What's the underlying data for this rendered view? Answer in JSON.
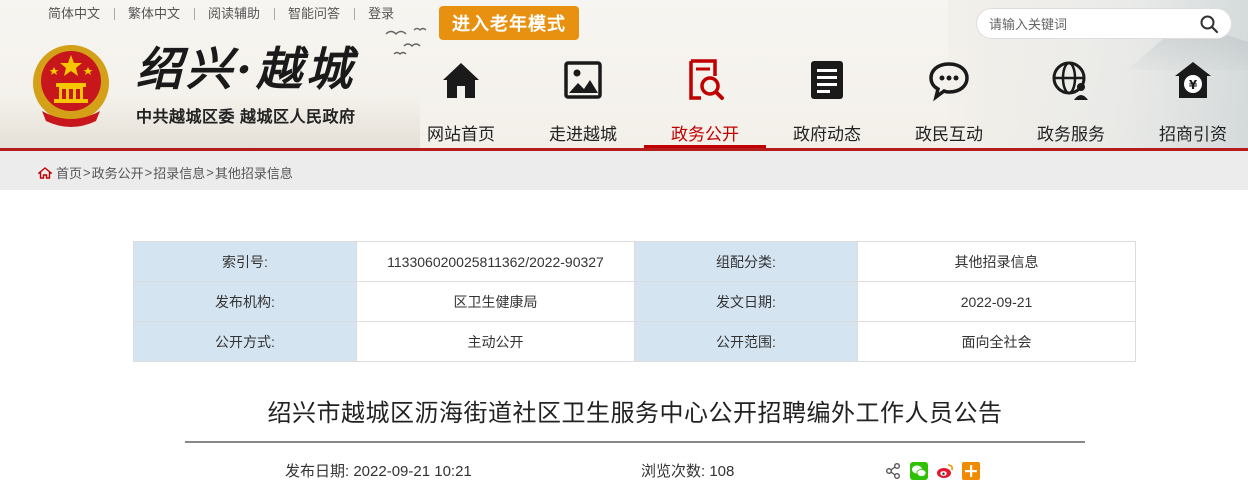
{
  "toplinks": [
    "简体中文",
    "繁体中文",
    "阅读辅助",
    "智能问答",
    "登录"
  ],
  "elder_mode": "进入老年模式",
  "search": {
    "placeholder": "请输入关键词"
  },
  "logo": {
    "title": "绍兴·越城",
    "subtitle": "中共越城区委 越城区人民政府"
  },
  "nav": [
    {
      "label": "网站首页",
      "icon": "home-icon"
    },
    {
      "label": "走进越城",
      "icon": "picture-icon"
    },
    {
      "label": "政务公开",
      "icon": "document-search-icon",
      "active": true
    },
    {
      "label": "政府动态",
      "icon": "news-icon"
    },
    {
      "label": "政民互动",
      "icon": "chat-icon"
    },
    {
      "label": "政务服务",
      "icon": "globe-user-icon"
    },
    {
      "label": "招商引资",
      "icon": "money-house-icon"
    }
  ],
  "breadcrumb": [
    "首页",
    "政务公开",
    "招录信息",
    "其他招录信息"
  ],
  "info": {
    "index_label": "索引号:",
    "index_value": "113306020025811362/2022-90327",
    "category_label": "组配分类:",
    "category_value": "其他招录信息",
    "org_label": "发布机构:",
    "org_value": "区卫生健康局",
    "date_label": "发文日期:",
    "date_value": "2022-09-21",
    "mode_label": "公开方式:",
    "mode_value": "主动公开",
    "scope_label": "公开范围:",
    "scope_value": "面向全社会"
  },
  "article": {
    "title": "绍兴市越城区沥海街道社区卫生服务中心公开招聘编外工作人员公告",
    "publish_label": "发布日期:",
    "publish_value": "2022-09-21 10:21",
    "views_label": "浏览次数:",
    "views_value": "108"
  },
  "colors": {
    "accent_red": "#c00000",
    "elder_orange": "#e8900f",
    "table_key_bg": "#d5e4f1"
  }
}
